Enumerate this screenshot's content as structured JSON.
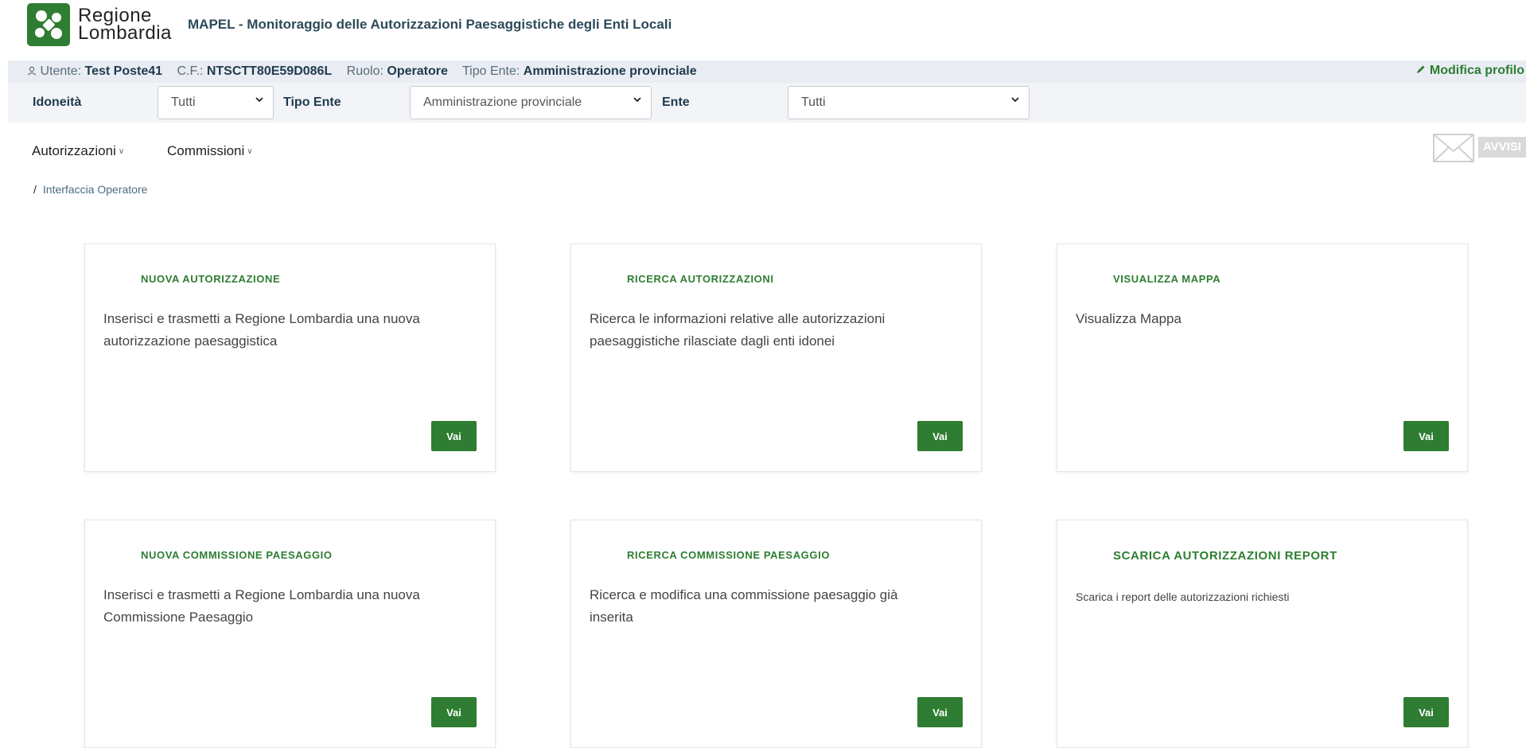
{
  "header": {
    "logo_line1": "Regione",
    "logo_line2": "Lombardia",
    "app_title": "MAPEL - Monitoraggio delle Autorizzazioni Paesaggistiche degli Enti Locali"
  },
  "userbar": {
    "user_label": "Utente:",
    "user_value": "Test Poste41",
    "cf_label": "C.F.:",
    "cf_value": "NTSCTT80E59D086L",
    "role_label": "Ruolo:",
    "role_value": "Operatore",
    "ente_type_label": "Tipo Ente:",
    "ente_type_value": "Amministrazione provinciale",
    "modify_label": "Modifica profilo"
  },
  "filters": {
    "idoneita_label": "Idoneità",
    "idoneita_value": "Tutti",
    "tipo_ente_label": "Tipo Ente",
    "tipo_ente_value": "Amministrazione provinciale",
    "ente_label": "Ente",
    "ente_value": "Tutti"
  },
  "nav": {
    "autorizzazioni": "Autorizzazioni",
    "commissioni": "Commissioni",
    "avvisi": "AVVISI"
  },
  "breadcrumb": {
    "separator": "/",
    "current": "Interfaccia Operatore"
  },
  "cards": [
    {
      "title": "NUOVA AUTORIZZAZIONE",
      "description": "Inserisci e trasmetti a Regione Lombardia una nuova autorizzazione paesaggistica",
      "button": "Vai"
    },
    {
      "title": "RICERCA AUTORIZZAZIONI",
      "description": "Ricerca le informazioni relative alle autorizzazioni paesaggistiche rilasciate dagli enti idonei",
      "button": "Vai"
    },
    {
      "title": "VISUALIZZA MAPPA",
      "description": "Visualizza Mappa",
      "button": "Vai"
    },
    {
      "title": "NUOVA COMMISSIONE PAESAGGIO",
      "description": "Inserisci e trasmetti a Regione Lombardia una nuova Commissione Paesaggio",
      "button": "Vai"
    },
    {
      "title": "RICERCA COMMISSIONE PAESAGGIO",
      "description": "Ricerca e modifica una commissione paesaggio già inserita",
      "button": "Vai"
    },
    {
      "title": "SCARICA AUTORIZZAZIONI REPORT",
      "description": "Scarica i report delle autorizzazioni richiesti",
      "button": "Vai"
    }
  ],
  "colors": {
    "accent": "#2e7d32",
    "userbar_bg": "#e9edf3",
    "filterbar_bg": "#f2f4f7"
  },
  "icons": [
    "regione-lombardia-logo",
    "user-icon",
    "pencil-icon",
    "chevron-down-icon",
    "envelope-icon"
  ]
}
